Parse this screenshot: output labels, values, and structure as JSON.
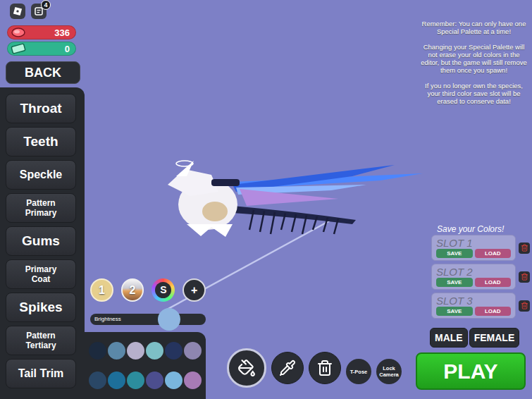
{
  "top_bar": {
    "notifications": "4"
  },
  "currencies": [
    {
      "name": "mushroom",
      "value": "336",
      "color": "#d63a48"
    },
    {
      "name": "ticket",
      "value": "0",
      "color": "#2fb58f"
    }
  ],
  "back_button": "BACK",
  "body_parts": [
    {
      "label": "Throat",
      "selected": false
    },
    {
      "label": "Teeth",
      "selected": false
    },
    {
      "label": "Speckle",
      "selected": false
    },
    {
      "label": "Pattern Primary",
      "selected": false
    },
    {
      "label": "Gums",
      "selected": false
    },
    {
      "label": "Primary Coat",
      "selected": false
    },
    {
      "label": "Spikes",
      "selected": false
    },
    {
      "label": "Pattern Tertiary",
      "selected": false
    },
    {
      "label": "Tail Trim",
      "selected": false
    }
  ],
  "palette_buttons": [
    {
      "label": "1",
      "kind": "solid"
    },
    {
      "label": "2",
      "kind": "split"
    },
    {
      "label": "S",
      "kind": "special"
    },
    {
      "label": "+",
      "kind": "add"
    }
  ],
  "brightness": {
    "label": "Brightness",
    "level": 0.68
  },
  "swatches": [
    {
      "color": "#1c2a3e"
    },
    {
      "color": "#5b88a8"
    },
    {
      "color": "#b6b0cc"
    },
    {
      "color": "#7dbfc6"
    },
    {
      "color": "#25345e"
    },
    {
      "color": "#8e86b0"
    },
    {
      "color": "#2a4766"
    },
    {
      "color": "#1d6f9a"
    },
    {
      "color": "#2c8d9d"
    },
    {
      "color": "#4c4e8e"
    },
    {
      "color": "#7ab6dd"
    },
    {
      "color": "#a77bb5"
    }
  ],
  "tools": [
    {
      "name": "bucket",
      "selected": true
    },
    {
      "name": "eyedropper",
      "selected": false
    },
    {
      "name": "trash",
      "selected": false
    }
  ],
  "toggles": [
    {
      "label": "T-Pose"
    },
    {
      "label": "Lock Camera"
    }
  ],
  "notice": [
    "Remember: You can only have one Special Palette at a time!",
    "Changing your Special Palette will not erase your old colors in the editor, but the game will still remove them once you spawn!",
    "If you no longer own the species, your third color save slot will be erased to conserve data!"
  ],
  "save_section": {
    "title": "Save your Colors!",
    "slots": [
      {
        "label": "SLOT 1",
        "save": "SAVE",
        "load": "LOAD"
      },
      {
        "label": "SLOT 2",
        "save": "SAVE",
        "load": "LOAD"
      },
      {
        "label": "SLOT 3",
        "save": "SAVE",
        "load": "LOAD"
      }
    ]
  },
  "gender": [
    {
      "label": "MALE",
      "selected": false
    },
    {
      "label": "FEMALE",
      "selected": false
    }
  ],
  "play_button": "PLAY"
}
